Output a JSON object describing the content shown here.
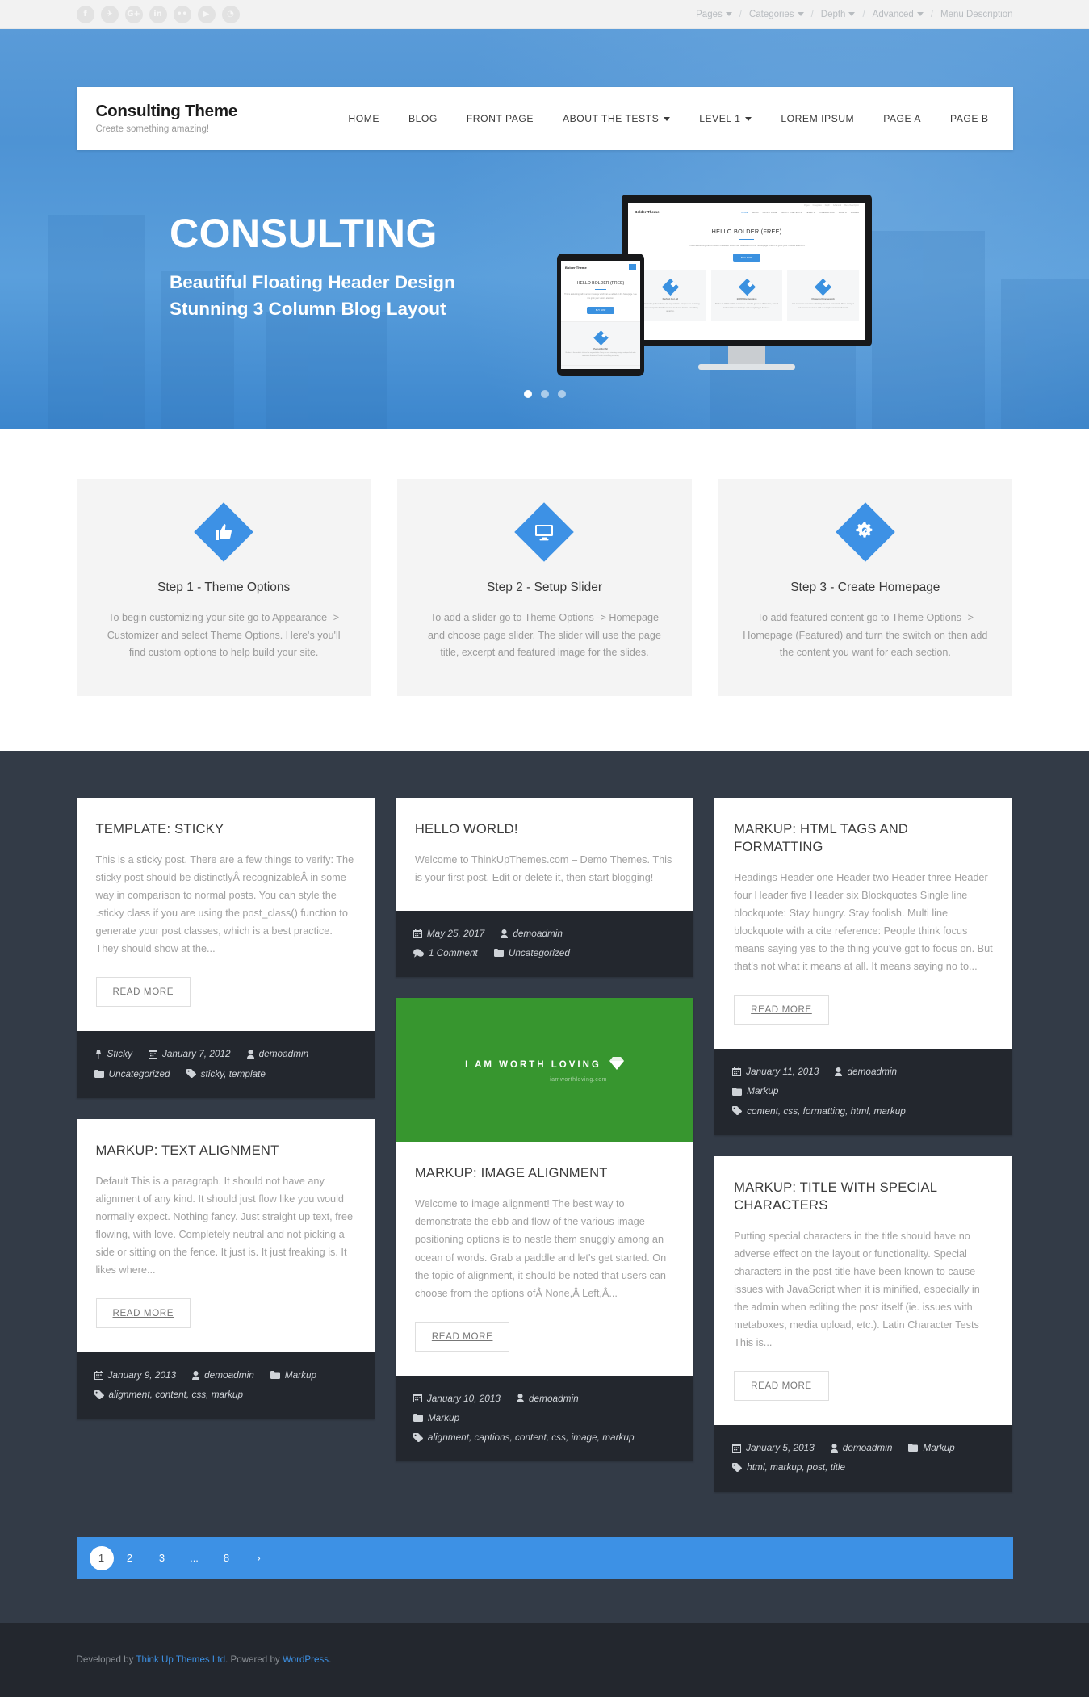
{
  "topbar": {
    "social": [
      {
        "name": "facebook-icon",
        "glyph": "f"
      },
      {
        "name": "twitter-icon",
        "glyph": "✈"
      },
      {
        "name": "googleplus-icon",
        "glyph": "G+"
      },
      {
        "name": "linkedin-icon",
        "glyph": "in"
      },
      {
        "name": "flickr-icon",
        "glyph": "••"
      },
      {
        "name": "youtube-icon",
        "glyph": "▶"
      },
      {
        "name": "rss-icon",
        "glyph": "◔"
      }
    ],
    "menu": [
      {
        "label": "Pages",
        "caret": true
      },
      {
        "label": "Categories",
        "caret": true
      },
      {
        "label": "Depth",
        "caret": true
      },
      {
        "label": "Advanced",
        "caret": true
      },
      {
        "label": "Menu Description",
        "caret": false
      }
    ],
    "separator": "/"
  },
  "header": {
    "site_title": "Consulting Theme",
    "tagline": "Create something amazing!",
    "nav": [
      {
        "label": "HOME",
        "caret": false
      },
      {
        "label": "BLOG",
        "caret": false
      },
      {
        "label": "FRONT PAGE",
        "caret": false
      },
      {
        "label": "ABOUT THE TESTS",
        "caret": true
      },
      {
        "label": "LEVEL 1",
        "caret": true
      },
      {
        "label": "LOREM IPSUM",
        "caret": false
      },
      {
        "label": "PAGE A",
        "caret": false
      },
      {
        "label": "PAGE B",
        "caret": false
      }
    ]
  },
  "slider": {
    "title": "CONSULTING",
    "subtitle_line1": "Beautiful Floating Header Design",
    "subtitle_line2": "Stunning 3 Column Blog Layout",
    "dots": 3,
    "active_dot": 1,
    "mockup": {
      "logo": "Bolder Theme",
      "menu": [
        "HOME",
        "BLOG",
        "FRONT PAGE",
        "ABOUT THE TESTS",
        "LEVEL 1",
        "LOREM IPSUM",
        "PAGE A",
        "PAGE B"
      ],
      "topmenu": [
        "Pages",
        "Categories",
        "Depth",
        "Advanced",
        "Menu Description"
      ],
      "heading": "HELLO BOLDER (FREE)",
      "paragraph": "This is a stunning call to action message which can be added on the homepage. Use it to grab your visitors attention.",
      "button": "BUY NOW",
      "columns": [
        {
          "title": "Perfect For All",
          "text": "Bolder is the perfect choice for any website. Easy to use stunning design and packed with awesome features. Create something amazing."
        },
        {
          "title": "100% Responsive",
          "text": "Bolder is 100% mobile responsive. It looks great on all devices, from 4 inch mobiles to desktops and everything in between."
        },
        {
          "title": "Powerful Framework",
          "text": "Get access to awesome Think Up Themes framework. Make changes and preview them live with our simple and powerful tools."
        }
      ],
      "tablet_section_title": "Perfect For All",
      "tablet_section_text": "Bolder is the perfect choice for any website. Easy to use stunning design and packed with awesome features. Create something amazing."
    }
  },
  "features": [
    {
      "icon": "thumbs-up-icon",
      "title": "Step 1 - Theme Options",
      "text": "To begin customizing your site go to Appearance -> Customizer and select Theme Options. Here's you'll find custom options to help build your site."
    },
    {
      "icon": "desktop-monitor-icon",
      "title": "Step 2 - Setup Slider",
      "text": "To add a slider go to Theme Options -> Homepage and choose page slider. The slider will use the page title, excerpt and featured image for the slides."
    },
    {
      "icon": "gears-icon",
      "title": "Step 3 - Create Homepage",
      "text": "To add featured content go to Theme Options -> Homepage (Featured) and turn the switch on then add the content you want for each section."
    }
  ],
  "blog": {
    "read_more": "READ MORE",
    "columns": [
      {
        "posts": [
          {
            "title": "TEMPLATE: STICKY",
            "excerpt": "This is a sticky post. There are a few things to verify: The sticky post should be distinctlyÂ recognizableÂ in some way in comparison to normal posts. You can style the .sticky class if you are using the post_class() function to generate your post classes, which is a best practice. They should show at the...",
            "has_read_more": true,
            "image": null,
            "meta": [
              [
                {
                  "icon": "pin-icon",
                  "text": "Sticky"
                },
                {
                  "icon": "calendar-icon",
                  "text": "January 7, 2012"
                },
                {
                  "icon": "user-icon",
                  "text": "demoadmin"
                }
              ],
              [
                {
                  "icon": "folder-icon",
                  "text": "Uncategorized"
                },
                {
                  "icon": "tag-icon",
                  "text": "sticky, template"
                }
              ]
            ]
          },
          {
            "title": "MARKUP: TEXT ALIGNMENT",
            "excerpt": "Default This is a paragraph. It should not have any alignment of any kind. It should just flow like you would normally expect. Nothing fancy. Just straight up text, free flowing, with love. Completely neutral and not picking a side or sitting on the fence. It just is. It just freaking is. It likes where...",
            "has_read_more": true,
            "image": null,
            "meta": [
              [
                {
                  "icon": "calendar-icon",
                  "text": "January 9, 2013"
                },
                {
                  "icon": "user-icon",
                  "text": "demoadmin"
                },
                {
                  "icon": "folder-icon",
                  "text": "Markup"
                }
              ],
              [
                {
                  "icon": "tag-icon",
                  "text": "alignment, content, css, markup"
                }
              ]
            ]
          }
        ]
      },
      {
        "posts": [
          {
            "title": "HELLO WORLD!",
            "excerpt": "Welcome to ThinkUpThemes.com – Demo Themes. This is your first post. Edit or delete it, then start blogging!",
            "has_read_more": false,
            "image": null,
            "meta": [
              [
                {
                  "icon": "calendar-icon",
                  "text": "May 25, 2017"
                },
                {
                  "icon": "user-icon",
                  "text": "demoadmin"
                }
              ],
              [
                {
                  "icon": "comment-icon",
                  "text": "1 Comment"
                },
                {
                  "icon": "folder-icon",
                  "text": "Uncategorized"
                }
              ]
            ]
          },
          {
            "title": "MARKUP: IMAGE ALIGNMENT",
            "excerpt": "Welcome to image alignment! The best way to demonstrate the ebb and flow of the various image positioning options is to nestle them snuggly among an ocean of words. Grab a paddle and let's get started. On the topic of alignment, it should be noted that users can choose from the options ofÂ None,Â Left,Â...",
            "has_read_more": true,
            "image": {
              "caption": "I AM WORTH LOVING",
              "sub_caption": "iamworthloving.com",
              "color": "#37962f",
              "icon": "diamond-icon"
            },
            "meta": [
              [
                {
                  "icon": "calendar-icon",
                  "text": "January 10, 2013"
                },
                {
                  "icon": "user-icon",
                  "text": "demoadmin"
                }
              ],
              [
                {
                  "icon": "folder-icon",
                  "text": "Markup"
                }
              ],
              [
                {
                  "icon": "tag-icon",
                  "text": "alignment, captions, content, css, image, markup"
                }
              ]
            ]
          }
        ]
      },
      {
        "posts": [
          {
            "title": "MARKUP: HTML TAGS AND FORMATTING",
            "excerpt": "Headings Header one Header two Header three Header four Header five Header six Blockquotes Single line blockquote: Stay hungry. Stay foolish. Multi line blockquote with a cite reference: People think focus means saying yes to the thing you've got to focus on. But that's not what it means at all. It means saying no to...",
            "has_read_more": true,
            "image": null,
            "meta": [
              [
                {
                  "icon": "calendar-icon",
                  "text": "January 11, 2013"
                },
                {
                  "icon": "user-icon",
                  "text": "demoadmin"
                }
              ],
              [
                {
                  "icon": "folder-icon",
                  "text": "Markup"
                }
              ],
              [
                {
                  "icon": "tag-icon",
                  "text": "content, css, formatting, html, markup"
                }
              ]
            ]
          },
          {
            "title": "MARKUP: TITLE WITH SPECIAL CHARACTERS",
            "excerpt": "Putting special characters in the title should have no adverse effect on the layout or functionality. Special characters in the post title have been known to cause issues with JavaScript when it is minified, especially in the admin when editing the post itself (ie. issues with metaboxes, media upload, etc.). Latin Character Tests This is...",
            "has_read_more": true,
            "image": null,
            "meta": [
              [
                {
                  "icon": "calendar-icon",
                  "text": "January 5, 2013"
                },
                {
                  "icon": "user-icon",
                  "text": "demoadmin"
                },
                {
                  "icon": "folder-icon",
                  "text": "Markup"
                }
              ],
              [
                {
                  "icon": "tag-icon",
                  "text": "html, markup, post, title"
                }
              ]
            ]
          }
        ]
      }
    ]
  },
  "pagination": {
    "pages": [
      "1",
      "2",
      "3",
      "...",
      "8",
      "›"
    ],
    "current": "1"
  },
  "footer": {
    "prefix": "Developed by ",
    "link1": "Think Up Themes Ltd",
    "middle": ". Powered by ",
    "link2": "WordPress",
    "suffix": "."
  },
  "colors": {
    "accent": "#3d91e5",
    "dark": "#333b47",
    "meta_dark": "#23272e",
    "image_green": "#37962f"
  }
}
